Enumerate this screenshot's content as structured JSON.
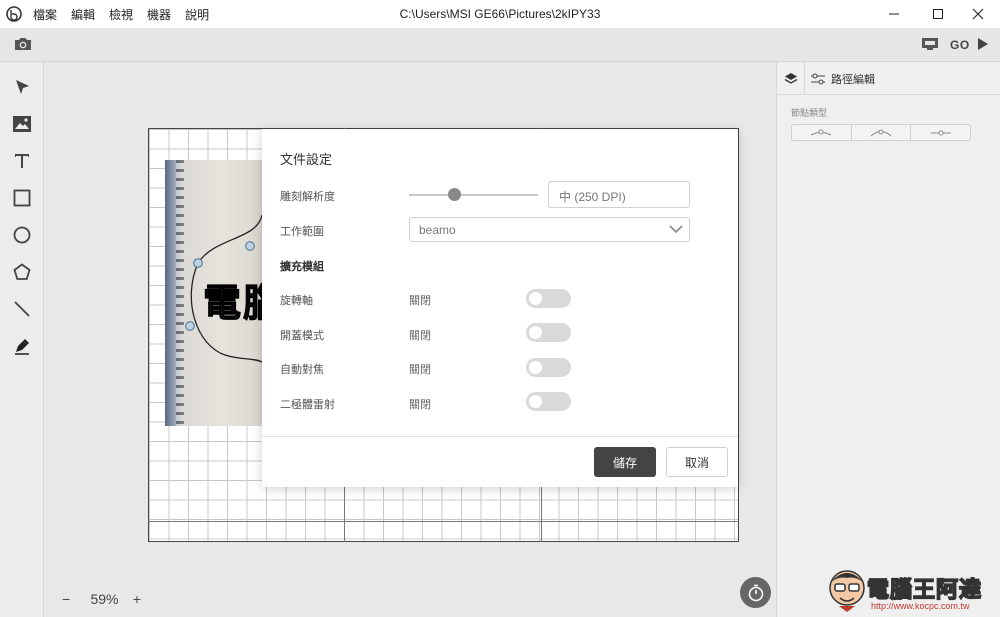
{
  "window": {
    "title": "C:\\Users\\MSI GE66\\Pictures\\2kIPY33",
    "menu": [
      "檔案",
      "編輯",
      "檢視",
      "機器",
      "說明"
    ]
  },
  "topbar": {
    "go_label": "GO"
  },
  "left_tools": [
    "select-tool",
    "image-tool",
    "text-tool",
    "rectangle-tool",
    "ellipse-tool",
    "polygon-tool",
    "line-tool",
    "pen-tool"
  ],
  "canvas": {
    "image_text": "電腦",
    "zoom_minus": "−",
    "zoom_value": "59%",
    "zoom_plus": "+"
  },
  "right_panel": {
    "tab_path_label": "路徑編輯",
    "section_label": "節點類型"
  },
  "dialog": {
    "title": "文件設定",
    "engrave_resolution_label": "雕刻解析度",
    "engrave_resolution_level": 0.35,
    "engrave_resolution_value": "中 (250 DPI)",
    "work_area_label": "工作範圍",
    "work_area_value": "beamo",
    "modules_header": "擴充模組",
    "options": [
      {
        "label": "旋轉軸",
        "value": "關閉",
        "enabled": false
      },
      {
        "label": "開蓋模式",
        "value": "關閉",
        "enabled": false
      },
      {
        "label": "自動對焦",
        "value": "關閉",
        "enabled": false
      },
      {
        "label": "二極體雷射",
        "value": "關閉",
        "enabled": false
      }
    ],
    "save_label": "儲存",
    "cancel_label": "取消"
  },
  "watermark": {
    "text": "電腦王阿達",
    "url": "http://www.kocpc.com.tw"
  }
}
